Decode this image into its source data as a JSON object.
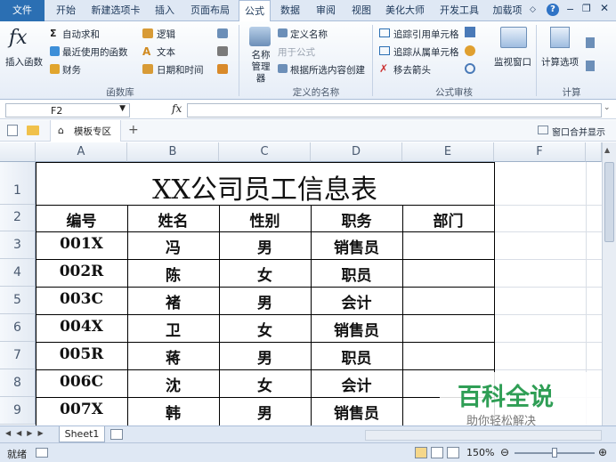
{
  "tabs": [
    "文件",
    "开始",
    "新建选项卡",
    "插入",
    "页面布局",
    "公式",
    "数据",
    "审阅",
    "视图",
    "美化大师",
    "开发工具",
    "加载项"
  ],
  "ribbon": {
    "insert_function": "插入函数",
    "autosum": "自动求和",
    "recent": "最近使用的函数",
    "finance": "财务",
    "logic": "逻辑",
    "text": "文本",
    "datetime": "日期和时间",
    "group_lib": "函数库",
    "name_mgr": "名称\n管理器",
    "define_name": "定义名称",
    "use_formula": "用于公式",
    "create_from_sel": "根据所选内容创建",
    "group_names": "定义的名称",
    "trace_prec": "追踪引用单元格",
    "trace_dep": "追踪从属单元格",
    "remove_arrows": "移去箭头",
    "group_audit": "公式审核",
    "watch": "监视窗口",
    "calc_options": "计算选项",
    "group_calc": "计算"
  },
  "formula_bar": {
    "name_box": "F2",
    "fx": "fx",
    "value": ""
  },
  "doc_tabs": {
    "template": "模板专区",
    "add": "+",
    "merge_window": "窗口合并显示"
  },
  "columns": [
    "A",
    "B",
    "C",
    "D",
    "E",
    "F"
  ],
  "rows": [
    "1",
    "2",
    "3",
    "4",
    "5",
    "6",
    "7",
    "8",
    "9"
  ],
  "sheet": {
    "title": "XX公司员工信息表",
    "headers": [
      "编号",
      "姓名",
      "性别",
      "职务",
      "部门"
    ],
    "data": [
      [
        "001X",
        "冯",
        "男",
        "销售员",
        ""
      ],
      [
        "002R",
        "陈",
        "女",
        "职员",
        ""
      ],
      [
        "003C",
        "褚",
        "男",
        "会计",
        ""
      ],
      [
        "004X",
        "卫",
        "女",
        "销售员",
        ""
      ],
      [
        "005R",
        "蒋",
        "男",
        "职员",
        ""
      ],
      [
        "006C",
        "沈",
        "女",
        "会计",
        ""
      ],
      [
        "007X",
        "韩",
        "男",
        "销售员",
        ""
      ]
    ]
  },
  "sheet_tab": "Sheet1",
  "status": {
    "ready": "就绪",
    "zoom": "150%"
  },
  "watermark": {
    "title": "百科全说",
    "subtitle": "助你轻松解决"
  },
  "colors": {
    "accent": "#2b6fb3",
    "watermark_green": "#2f9e55"
  }
}
